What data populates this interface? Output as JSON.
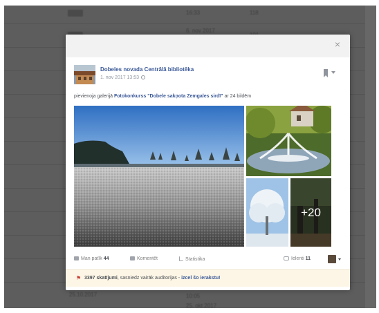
{
  "background_rows": [
    {
      "date": "",
      "time": "16:33",
      "count": "118"
    },
    {
      "date": "6. nov 2017",
      "time": "",
      "count": "101"
    },
    {
      "date": "",
      "time": "",
      "count": ""
    },
    {
      "date": "",
      "time": "",
      "count": ""
    },
    {
      "date": "",
      "time": "",
      "count": ""
    },
    {
      "date": "",
      "time": "",
      "count": ""
    },
    {
      "date": "",
      "time": "",
      "count": ""
    },
    {
      "date": "",
      "time": "",
      "count": ""
    },
    {
      "date": "",
      "time": "",
      "count": ""
    },
    {
      "date": "",
      "time": "",
      "count": ""
    },
    {
      "date": "25.10.2017",
      "time": "10:05",
      "count": ""
    },
    {
      "date": "25. okt 2017",
      "time": "",
      "count": ""
    }
  ],
  "modal": {
    "close_label": "×"
  },
  "post": {
    "page_name": "Dobeles novada Centrālā bibliotēka",
    "timestamp": "1. nov 2017 13:53",
    "text_prefix": "pievienoja galerijā ",
    "gallery_link": "Fotokonkurss \"Dobele sakņota Zemgales sirdī\"",
    "text_suffix": " ar 24 bildēm",
    "more_photos": "+20"
  },
  "actions": {
    "like_label": "Man patīk",
    "like_count": "44",
    "comment_label": "Komentēt",
    "stats_label": "Statistika",
    "shares_label": "Ielenti",
    "shares_count": "11"
  },
  "reach": {
    "count": "3397 skatījumi",
    "middle": ", sasniedz vairāk auditorijas - ",
    "cta": "izcel šo ierakstu!"
  },
  "colors": {
    "link": "#3b5998",
    "backdrop": "#5d5d5d",
    "reach_bg": "#fdf6e6"
  },
  "icons": [
    "close-icon",
    "globe-icon",
    "bookmark-icon",
    "chevron-down-icon",
    "like-icon",
    "comment-icon",
    "stats-icon",
    "share-icon",
    "flag-icon"
  ]
}
